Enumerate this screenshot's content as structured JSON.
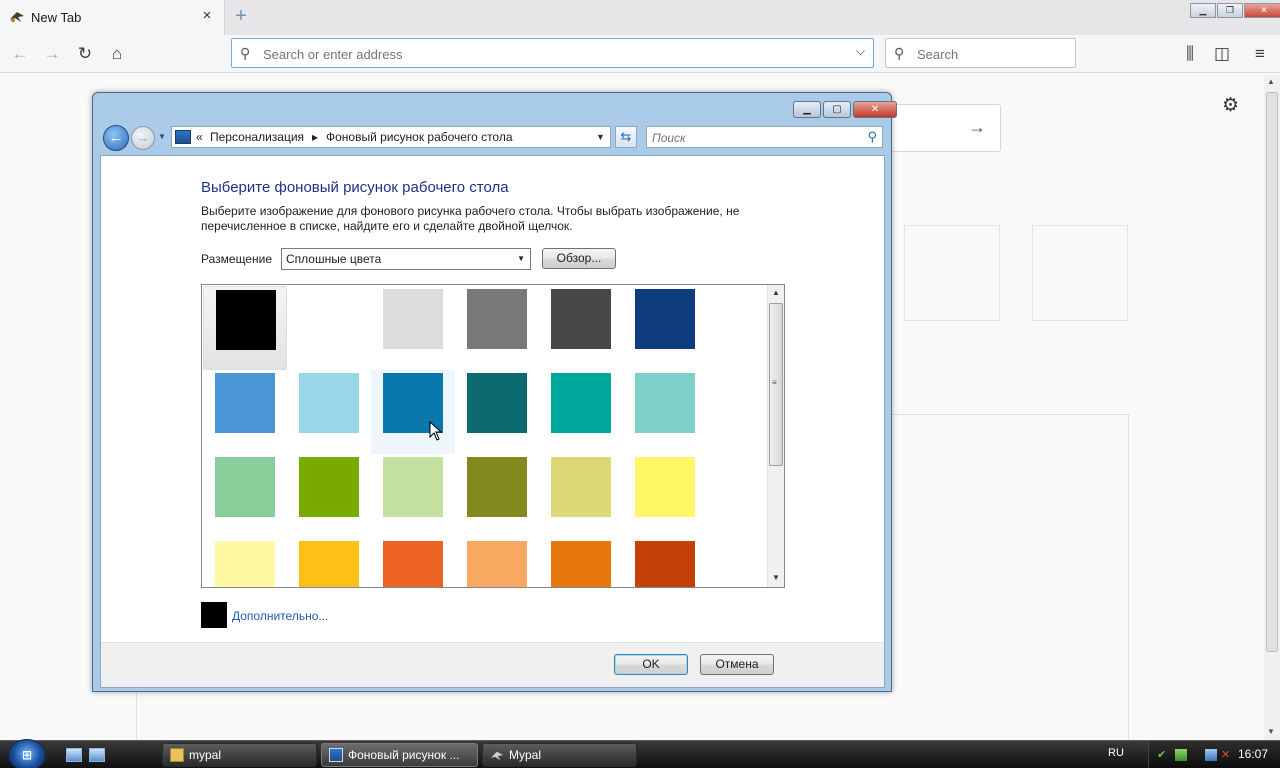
{
  "browser": {
    "tab_title": "New Tab",
    "tab_close": "×",
    "new_tab": "+",
    "url_placeholder": "Search or enter address",
    "search_placeholder": "Search"
  },
  "dialog": {
    "breadcrumb": [
      "«",
      "Персонализация",
      "▸",
      "Фоновый рисунок рабочего стола"
    ],
    "search_placeholder": "Поиск",
    "heading": "Выберите фоновый рисунок рабочего стола",
    "description": "Выберите изображение для фонового рисунка рабочего стола. Чтобы выбрать изображение, не перечисленное в списке, найдите его и сделайте двойной щелчок.",
    "placement_label": "Размещение",
    "placement_value": "Сплошные цвета",
    "browse_label": "Обзор...",
    "more_label": "Дополнительно...",
    "ok_label": "OK",
    "cancel_label": "Отмена",
    "selected_index": 0,
    "hover_index": 8,
    "swatches": [
      "#000000",
      "#ffffff",
      "#dcdcdc",
      "#787878",
      "#484848",
      "#0e3c7e",
      "#4a96d6",
      "#9ad6ea",
      "#0a78aa",
      "#0d6a6e",
      "#00a89c",
      "#7ecfc8",
      "#88ce9a",
      "#78aa00",
      "#c4e0a0",
      "#828a1e",
      "#dcd878",
      "#fef664",
      "#fef8a0",
      "#fec014",
      "#ec6220",
      "#f8a860",
      "#e6780c",
      "#c44208"
    ],
    "more_color": "#000000"
  },
  "taskbar": {
    "items": [
      {
        "label": "mypal",
        "active": false
      },
      {
        "label": "Фоновый рисунок ...",
        "active": true
      },
      {
        "label": "Mypal",
        "active": false
      }
    ],
    "language": "RU",
    "clock": "16:07"
  }
}
